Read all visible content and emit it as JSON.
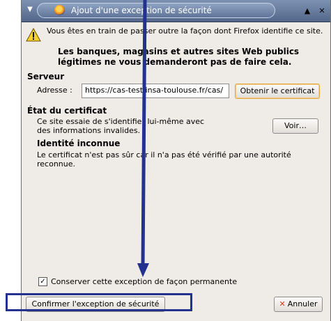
{
  "window": {
    "title": "Ajout d'une exception de sécurité",
    "menu_icon": "menu-down-icon",
    "maximize_icon": "up-triangle-icon",
    "close_icon": "close-icon"
  },
  "intro": {
    "text": "Vous êtes en train de passer outre la façon dont Firefox identifie ce site.",
    "bold": "Les banques, magasins et autres sites Web publics légitimes ne vous demanderont pas de faire cela."
  },
  "server": {
    "heading": "Serveur",
    "address_label": "Adresse :",
    "address_value": "https://cas-test.insa-toulouse.fr/cas/",
    "get_cert_label": "Obtenir le certificat"
  },
  "cert_status": {
    "heading": "État du certificat",
    "description": "Ce site essaie de s'identifier lui-même avec des informations invalides.",
    "view_label": "Voir…",
    "subheading": "Identité inconnue",
    "detail": "Le certificat n'est pas sûr car il n'a pas été vérifié par une autorité reconnue."
  },
  "permanent": {
    "label": "Conserver cette exception de façon permanente",
    "checked": true
  },
  "actions": {
    "confirm_label": "Confirmer l'exception de sécurité",
    "cancel_label": "Annuler"
  },
  "colors": {
    "annotation": "#23318f",
    "titlebar": "#5f7498",
    "dialog_bg": "#efebe7"
  }
}
